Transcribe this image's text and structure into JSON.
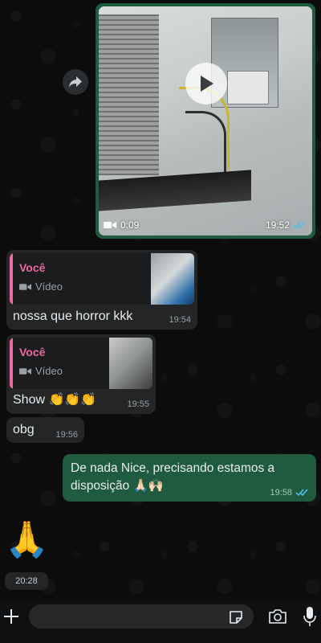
{
  "video_message": {
    "duration": "0:09",
    "time": "19:52"
  },
  "messages": [
    {
      "reply": {
        "author": "Você",
        "kind": "Vídeo"
      },
      "text": "nossa que horror kkk",
      "time": "19:54"
    },
    {
      "reply": {
        "author": "Você",
        "kind": "Vídeo"
      },
      "text": "Show 👏👏👏",
      "time": "19:55"
    },
    {
      "text": "obg",
      "time": "19:56"
    }
  ],
  "outgoing_text": {
    "text": "De nada Nice, precisando estamos a disposição 🙏🏻🙌🏻",
    "time": "19:58"
  },
  "emoji_message": {
    "emoji": "🙏",
    "time": "20:28"
  },
  "composer": {
    "placeholder": ""
  },
  "colors": {
    "outgoing_bubble": "#1f5c3f",
    "incoming_bubble": "#232526",
    "reply_author": "#ec6a9d",
    "read_ticks": "#53bdeb"
  },
  "icons": [
    "forward-icon",
    "play-icon",
    "video-camera-icon",
    "double-check-icon",
    "plus-icon",
    "sticker-icon",
    "camera-icon",
    "microphone-icon"
  ]
}
